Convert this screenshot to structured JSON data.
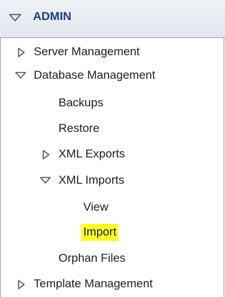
{
  "header": {
    "title": "ADMIN",
    "toggle_icon": "chevron-down-icon"
  },
  "tree": {
    "server_management": {
      "label": "Server Management",
      "state": "collapsed"
    },
    "database_management": {
      "label": "Database Management",
      "state": "expanded",
      "children": {
        "backups": {
          "label": "Backups"
        },
        "restore": {
          "label": "Restore"
        },
        "xml_exports": {
          "label": "XML Exports",
          "state": "collapsed"
        },
        "xml_imports": {
          "label": "XML Imports",
          "state": "expanded",
          "children": {
            "view": {
              "label": "View"
            },
            "import": {
              "label": "Import",
              "highlighted": true,
              "highlight_color": "#ffff2a"
            }
          }
        },
        "orphan_files": {
          "label": "Orphan Files"
        }
      }
    },
    "template_management": {
      "label": "Template Management",
      "state": "collapsed"
    }
  }
}
